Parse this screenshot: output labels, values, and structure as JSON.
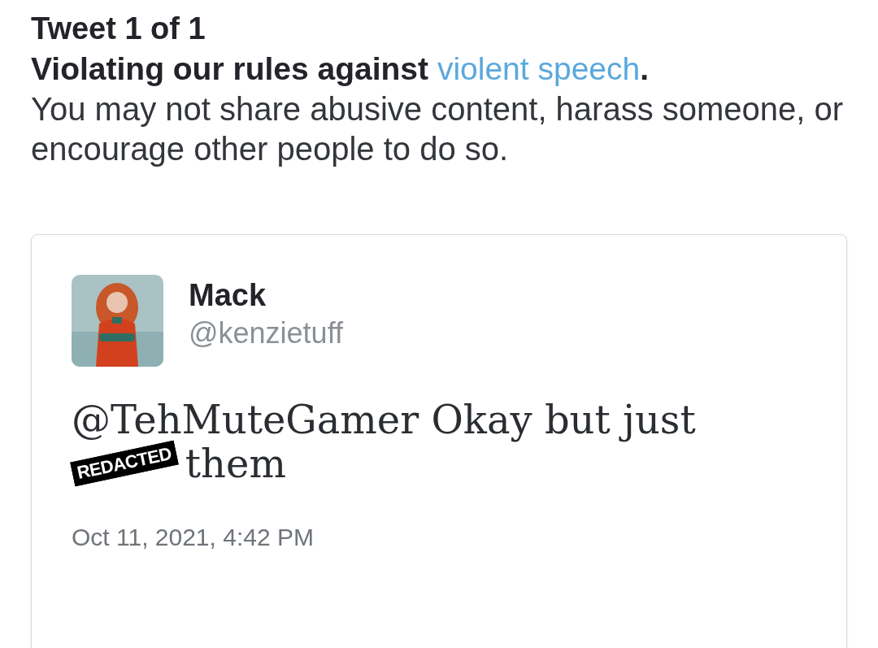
{
  "heading": "Tweet 1 of 1",
  "rule": {
    "title_prefix": "Violating our rules against ",
    "link": "violent speech",
    "title_suffix": ".",
    "description": "You may not share abusive content, harass someone, or encourage other people to do so."
  },
  "tweet": {
    "name": "Mack",
    "handle": "@kenzietuff",
    "line_1": "@TehMuteGamer Okay but just",
    "redaction_label": "REDACTED",
    "line_2_rest": "them",
    "timestamp": "Oct 11, 2021, 4:42 PM"
  }
}
